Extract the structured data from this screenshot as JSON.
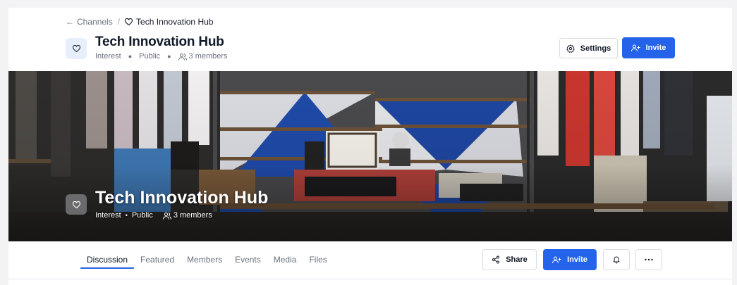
{
  "breadcrumb": {
    "parent_label": "Channels",
    "separator": "/",
    "current_label": "Tech Innovation Hub"
  },
  "channel": {
    "name": "Tech Innovation Hub",
    "category": "Interest",
    "visibility": "Public",
    "members_text": "3 members"
  },
  "header_actions": {
    "settings_label": "Settings",
    "invite_label": "Invite"
  },
  "banner": {
    "title": "Tech Innovation Hub",
    "category": "Interest",
    "visibility": "Public",
    "members_text": "3 members"
  },
  "tabs": [
    {
      "label": "Discussion",
      "active": true
    },
    {
      "label": "Featured",
      "active": false
    },
    {
      "label": "Members",
      "active": false
    },
    {
      "label": "Events",
      "active": false
    },
    {
      "label": "Media",
      "active": false
    },
    {
      "label": "Files",
      "active": false
    }
  ],
  "toolbar": {
    "share_label": "Share",
    "invite_label": "Invite"
  },
  "icons": {
    "channel": "heart-icon",
    "back": "arrow-left-icon",
    "members": "users-icon",
    "settings": "gear-icon",
    "invite": "user-plus-icon",
    "share": "share-icon",
    "notifications": "bell-icon",
    "more": "ellipsis-icon"
  },
  "colors": {
    "primary": "#2563eb",
    "avatar_bg": "#e8effc",
    "page_bg": "#f3f3f5"
  }
}
